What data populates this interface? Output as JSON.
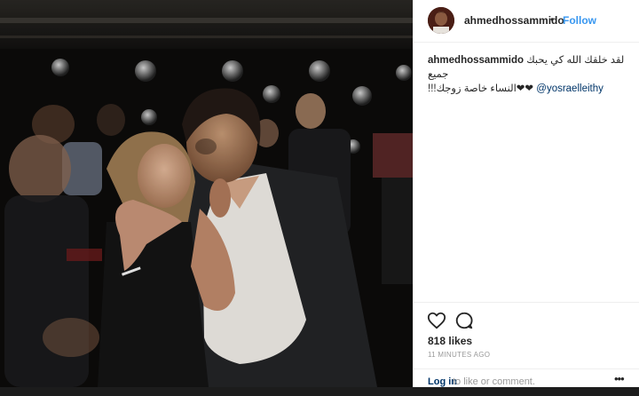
{
  "post": {
    "username": "ahmedhossammido",
    "separator": "•",
    "follow_label": "Follow",
    "caption_user": "ahmedhossammido",
    "caption_line1": "لقد خلقك الله كي يحبك جميع",
    "caption_line2": "النساء خاصة زوجك!!!",
    "caption_hearts": "❤❤",
    "caption_mention": "@yosraelleithy",
    "likes": "818 likes",
    "timestamp": "11 MINUTES AGO",
    "login_label": "Log in",
    "login_rest": "to like or comment.",
    "more_label": "•••"
  },
  "icons": {
    "like": "heart-icon",
    "comment": "comment-icon",
    "more": "more-options-icon"
  },
  "colors": {
    "link_blue": "#3897f0",
    "mention_blue": "#003569",
    "text": "#262626",
    "muted": "#999999"
  }
}
